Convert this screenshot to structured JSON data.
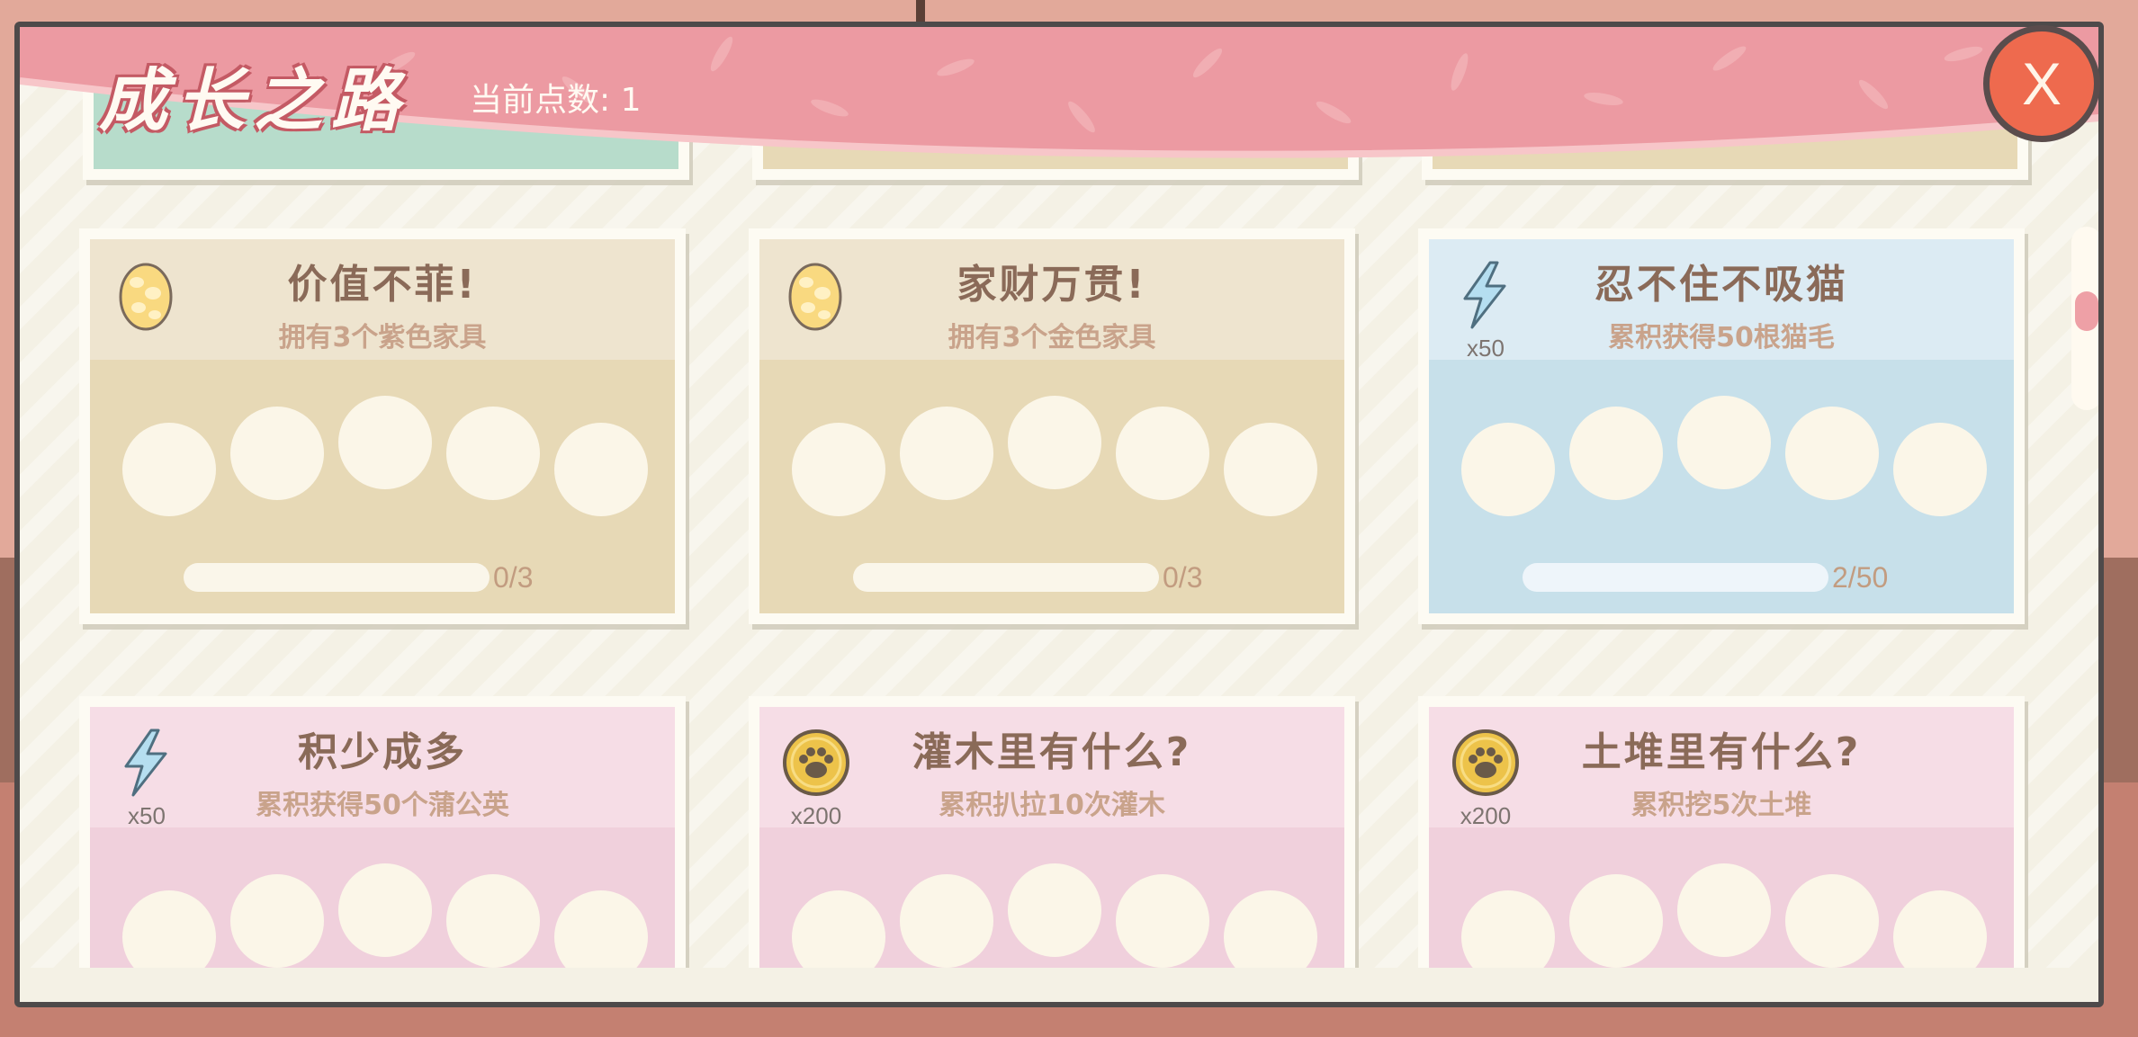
{
  "header": {
    "title": "成长之路",
    "points_label": "当前点数: 1"
  },
  "close_button": {
    "label": "X"
  },
  "cards": [
    {
      "title": "价值不菲!",
      "description": "拥有3个紫色家具",
      "reward_icon": "egg-icon",
      "reward_count": "",
      "progress_text": "0/3",
      "progress": 0,
      "theme": "tan"
    },
    {
      "title": "家财万贯!",
      "description": "拥有3个金色家具",
      "reward_icon": "egg-icon",
      "reward_count": "",
      "progress_text": "0/3",
      "progress": 0,
      "theme": "tan"
    },
    {
      "title": "忍不住不吸猫",
      "description": "累积获得50根猫毛",
      "reward_icon": "lightning-icon",
      "reward_count": "x50",
      "progress_text": "2/50",
      "progress": 0.04,
      "theme": "blue"
    },
    {
      "title": "积少成多",
      "description": "累积获得50个蒲公英",
      "reward_icon": "lightning-icon",
      "reward_count": "x50",
      "theme": "pink"
    },
    {
      "title": "灌木里有什么?",
      "description": "累积扒拉10次灌木",
      "reward_icon": "paw-coin-icon",
      "reward_count": "x200",
      "theme": "pink"
    },
    {
      "title": "土堆里有什么?",
      "description": "累积挖5次土堆",
      "reward_icon": "paw-coin-icon",
      "reward_count": "x200",
      "theme": "pink"
    }
  ],
  "colors": {
    "header_pink": "#ec9aa2",
    "close_button": "#ee6a4e",
    "panel_bg": "#f4f1e5",
    "card_tan": "#e7d9b6",
    "card_blue": "#c7e0ea",
    "card_pink": "#f0d0dc"
  }
}
